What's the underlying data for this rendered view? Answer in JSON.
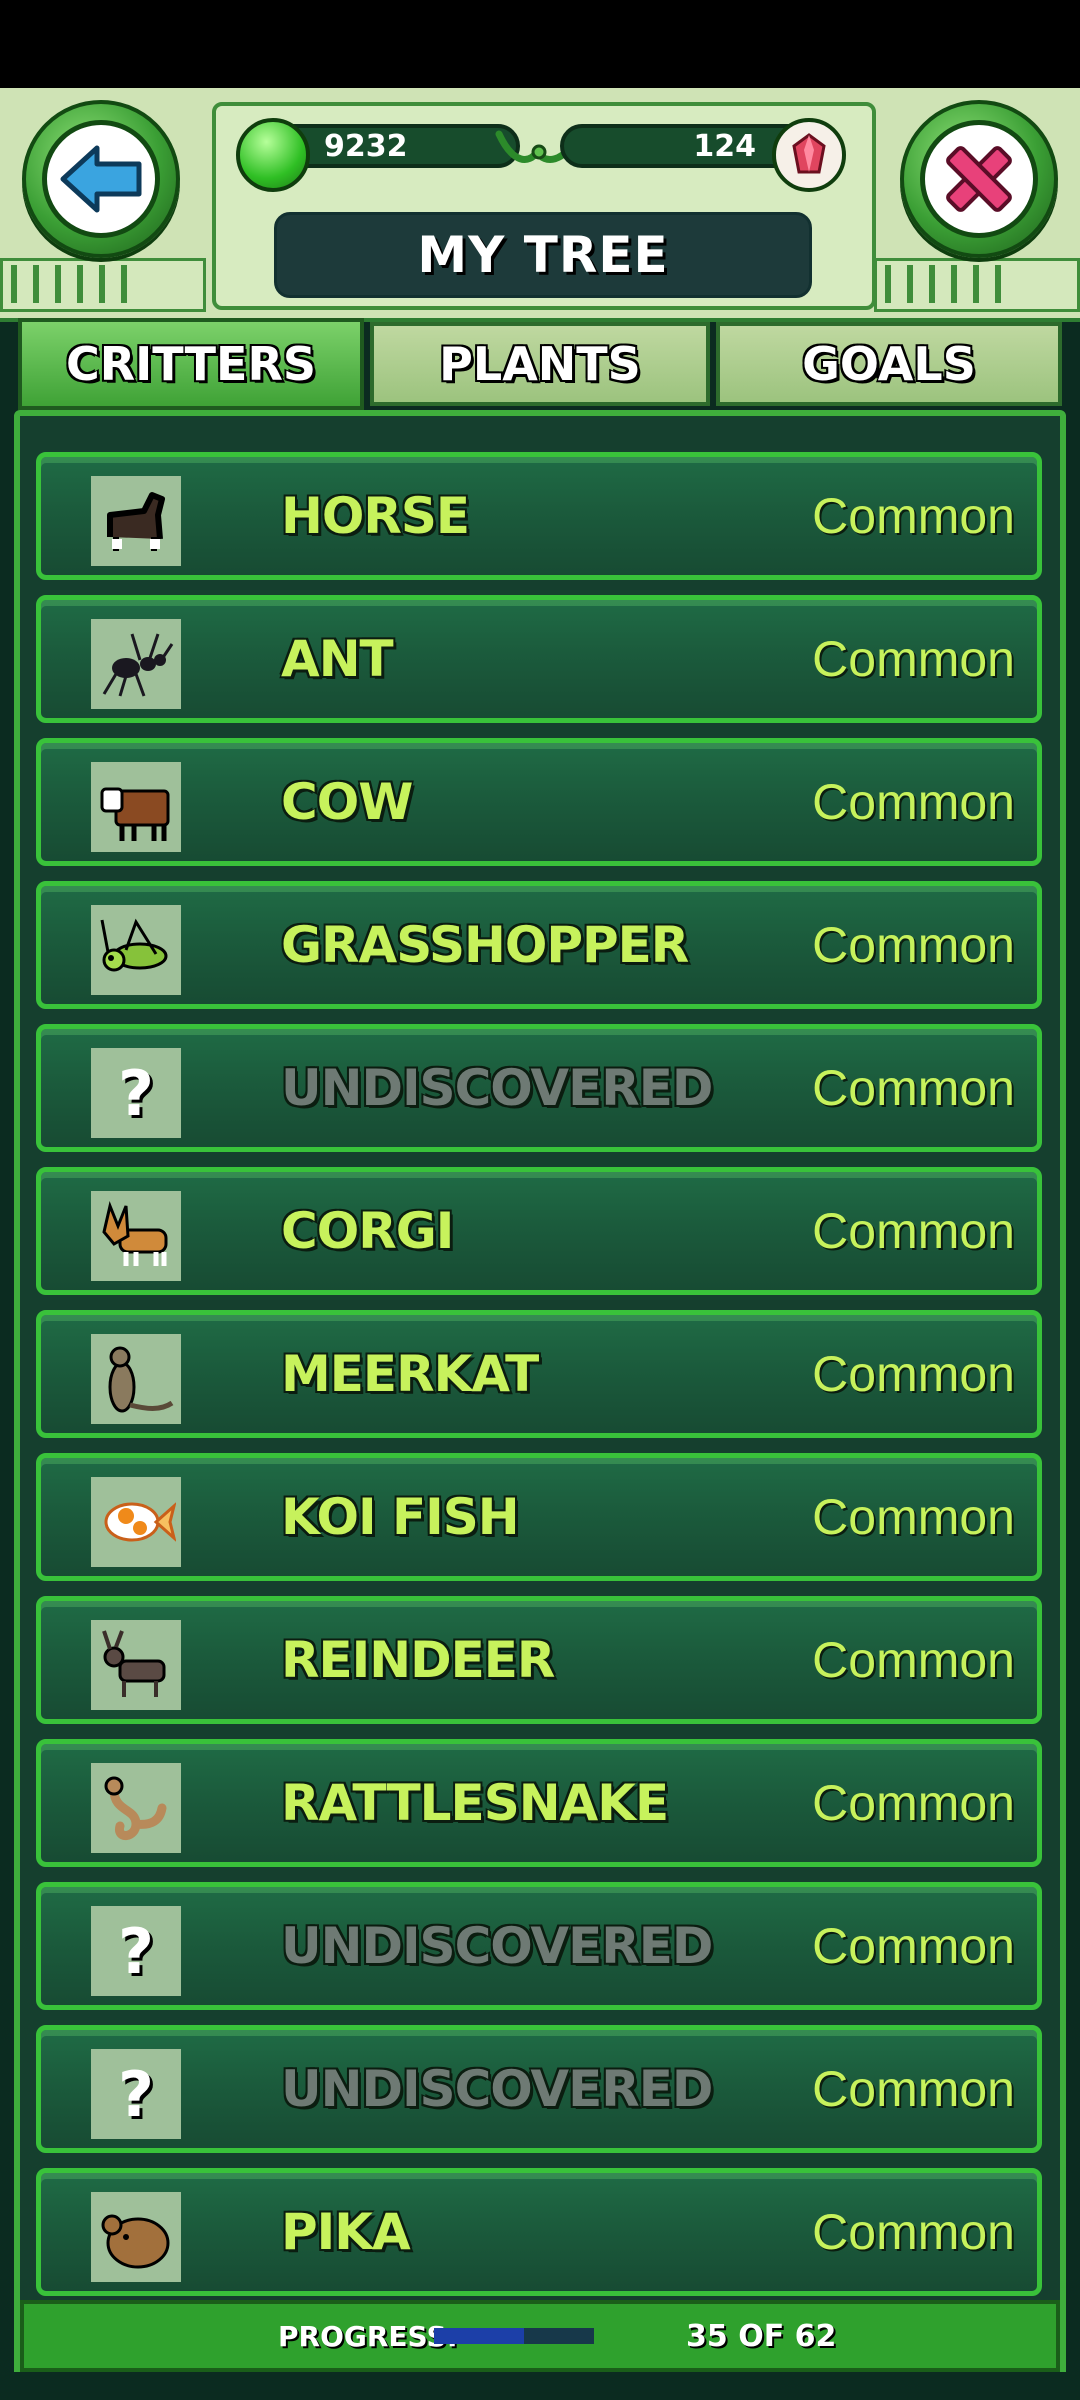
{
  "header": {
    "title": "MY TREE",
    "gems": "9232",
    "crystals": "124",
    "back_icon": "back-arrow-icon",
    "close_icon": "close-x-icon"
  },
  "tabs": [
    {
      "label": "CRITTERS",
      "active": true
    },
    {
      "label": "PLANTS",
      "active": false
    },
    {
      "label": "GOALS",
      "active": false
    }
  ],
  "critters": [
    {
      "name": "HORSE",
      "rarity": "Common",
      "discovered": true,
      "icon": "horse-icon"
    },
    {
      "name": "ANT",
      "rarity": "Common",
      "discovered": true,
      "icon": "ant-icon"
    },
    {
      "name": "COW",
      "rarity": "Common",
      "discovered": true,
      "icon": "cow-icon"
    },
    {
      "name": "GRASSHOPPER",
      "rarity": "Common",
      "discovered": true,
      "icon": "grasshopper-icon"
    },
    {
      "name": "UNDISCOVERED",
      "rarity": "Common",
      "discovered": false,
      "icon": "question-mark-icon"
    },
    {
      "name": "CORGI",
      "rarity": "Common",
      "discovered": true,
      "icon": "corgi-icon"
    },
    {
      "name": "MEERKAT",
      "rarity": "Common",
      "discovered": true,
      "icon": "meerkat-icon"
    },
    {
      "name": "KOI FISH",
      "rarity": "Common",
      "discovered": true,
      "icon": "koi-fish-icon"
    },
    {
      "name": "REINDEER",
      "rarity": "Common",
      "discovered": true,
      "icon": "reindeer-icon"
    },
    {
      "name": "RATTLESNAKE",
      "rarity": "Common",
      "discovered": true,
      "icon": "rattlesnake-icon"
    },
    {
      "name": "UNDISCOVERED",
      "rarity": "Common",
      "discovered": false,
      "icon": "question-mark-icon"
    },
    {
      "name": "UNDISCOVERED",
      "rarity": "Common",
      "discovered": false,
      "icon": "question-mark-icon"
    },
    {
      "name": "PIKA",
      "rarity": "Common",
      "discovered": true,
      "icon": "pika-icon"
    }
  ],
  "progress": {
    "label": "PROGRESS:",
    "text": "35 OF 62",
    "value": 35,
    "total": 62
  },
  "colors": {
    "accent_green": "#39c23a",
    "name_text": "#c7f25c",
    "undiscovered_text": "#6e7a74",
    "progress_fill": "#1c3fa8"
  }
}
